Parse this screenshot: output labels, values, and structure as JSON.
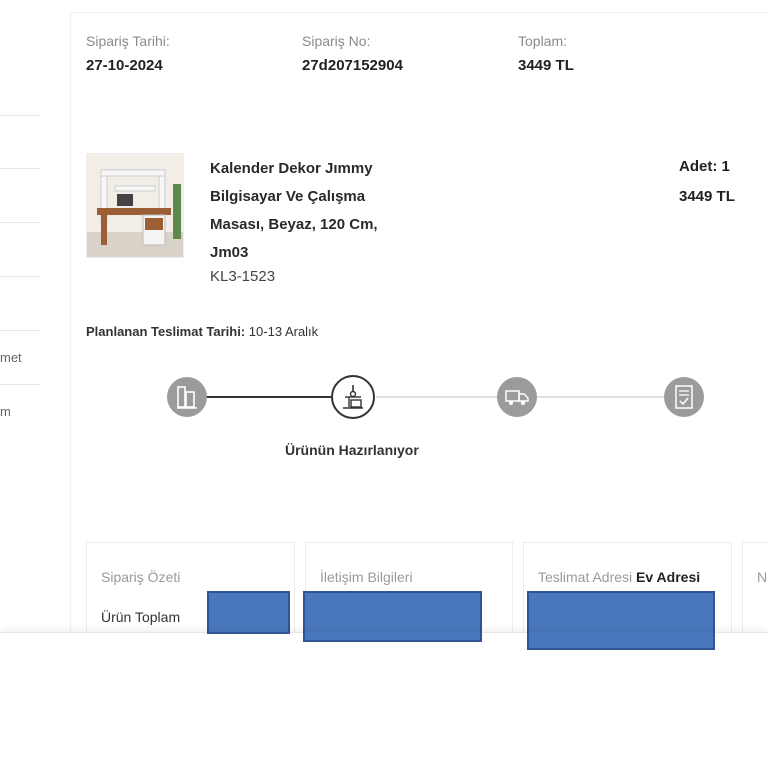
{
  "sidebar": {
    "fragments": [
      "met",
      "m"
    ]
  },
  "order": {
    "date_label": "Sipariş Tarihi:",
    "date_value": "27-10-2024",
    "no_label": "Sipariş No:",
    "no_value": "27d207152904",
    "total_label": "Toplam:",
    "total_value": "3449 TL"
  },
  "product": {
    "title": "Kalender Dekor Jımmy Bilgisayar Ve Çalışma Masası, Beyaz, 120 Cm, Jm03",
    "sku": "KL3-1523",
    "qty_label": "Adet:",
    "qty_value": "1",
    "price": "3449 TL"
  },
  "delivery": {
    "label": "Planlanan Teslimat Tarihi:",
    "value": "10-13 Aralık"
  },
  "tracker": {
    "steps": [
      {
        "icon": "order-received-icon",
        "state": "done"
      },
      {
        "icon": "preparing-icon",
        "state": "active"
      },
      {
        "icon": "shipping-truck-icon",
        "state": "pending"
      },
      {
        "icon": "delivered-document-icon",
        "state": "pending"
      }
    ],
    "active_label": "Ürünün Hazırlanıyor"
  },
  "info_boxes": {
    "summary_title": "Sipariş Özeti",
    "summary_row_label": "Ürün Toplam",
    "contact_title": "İletişim Bilgileri",
    "address_title": "Teslimat Adresi",
    "address_type": "Ev Adresi",
    "fourth_fragment": "No"
  },
  "colors": {
    "accent_dark": "#333333",
    "step_inactive": "#9b9b9b",
    "redaction": "#4a78bd"
  }
}
